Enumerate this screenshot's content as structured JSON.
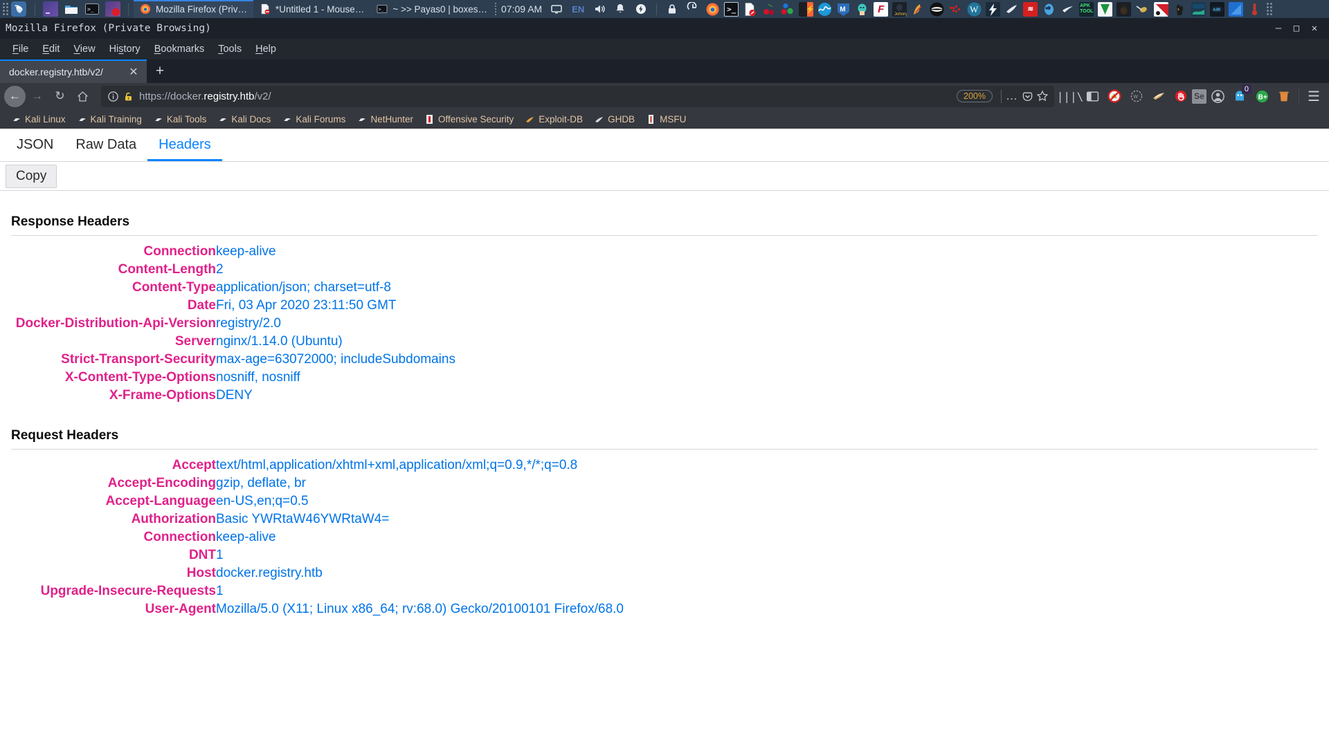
{
  "taskbar": {
    "grip_icon": "drag-grip-icon",
    "kali_logo": "kali-dragon-logo",
    "launchers": [
      {
        "name": "terminal-emulator-launcher",
        "icon": "monitor-purple-icon"
      },
      {
        "name": "file-manager-launcher",
        "icon": "folder-icon"
      },
      {
        "name": "terminal-launcher",
        "icon": "terminal-icon"
      },
      {
        "name": "screen-recorder-launcher",
        "icon": "monitor-record-icon"
      }
    ],
    "windows": [
      {
        "label": "Mozilla Firefox (Priv…",
        "icon": "firefox-icon",
        "active": true
      },
      {
        "label": "*Untitled 1 - Mouse…",
        "icon": "mousepad-icon",
        "active": false
      },
      {
        "label": "~ >> Payas0 | boxes…",
        "icon": "terminal-icon",
        "active": false
      }
    ],
    "clock": "07:09 AM",
    "tray": [
      {
        "name": "display-icon",
        "glyph": "⬜"
      },
      {
        "name": "keyboard-language-indicator",
        "glyph": "EN"
      },
      {
        "name": "volume-icon",
        "glyph": "🔊"
      },
      {
        "name": "notifications-bell-icon",
        "glyph": "🔔"
      },
      {
        "name": "power-manager-icon",
        "glyph": "⚡"
      },
      {
        "name": "lock-screen-icon",
        "glyph": "🔒"
      },
      {
        "name": "logout-icon",
        "glyph": "↪"
      }
    ],
    "app_icons": [
      {
        "name": "firefox-app-icon",
        "color": "#e8651a",
        "glyph": "🦊"
      },
      {
        "name": "terminal-app-icon",
        "color": "#101418",
        "glyph": ">_"
      },
      {
        "name": "no-document-app-icon",
        "color": "#f2f2f2",
        "glyph": "⊘"
      },
      {
        "name": "cherrytree-app-icon",
        "color": "#c8102e",
        "glyph": "❥"
      },
      {
        "name": "bloodhound-app-icon",
        "color": "#1c74d4",
        "glyph": "●"
      },
      {
        "name": "burpsuite-app-icon",
        "color": "#ff6633",
        "glyph": "⚡"
      },
      {
        "name": "wireshark-app-icon",
        "color": "#1d98d9",
        "glyph": "∿"
      },
      {
        "name": "metasploit-app-icon",
        "color": "#2c6dbb",
        "glyph": "M"
      },
      {
        "name": "beef-app-icon",
        "color": "#39b9b0",
        "glyph": "🐮"
      },
      {
        "name": "faraday-app-icon",
        "color": "#c41230",
        "glyph": "F"
      },
      {
        "name": "johnny-app-icon",
        "color": "#1a1a1a",
        "glyph": "J"
      },
      {
        "name": "hydra-app-icon",
        "color": "#b8341a",
        "glyph": "H"
      },
      {
        "name": "anonymous-app-icon",
        "color": "#111111",
        "glyph": "◑"
      },
      {
        "name": "sqlmap-app-icon",
        "color": "#d42020",
        "glyph": "⌨"
      },
      {
        "name": "wordpress-wpscan-app-icon",
        "color": "#21759b",
        "glyph": "W"
      },
      {
        "name": "zaproxy-app-icon",
        "color": "#1b4f8c",
        "glyph": "⚡"
      },
      {
        "name": "sqlninja-app-icon",
        "color": "#2b3a42",
        "glyph": "✒"
      },
      {
        "name": "nikto-app-icon",
        "color": "#cc0000",
        "glyph": "≣"
      },
      {
        "name": "maltego-app-icon",
        "color": "#3b8ed0",
        "glyph": "○"
      },
      {
        "name": "recon-ng-app-icon",
        "color": "#e8e8e8",
        "glyph": "➤"
      },
      {
        "name": "apktool-app-icon",
        "color": "#2f8f4e",
        "glyph": "A"
      },
      {
        "name": "vim-app-icon",
        "color": "#19953d",
        "glyph": "V"
      },
      {
        "name": "beetle-app-icon",
        "color": "#1a1a1a",
        "glyph": "🐜"
      },
      {
        "name": "wasp-app-icon",
        "color": "#c8a23b",
        "glyph": "🐝"
      },
      {
        "name": "nmap-app-icon",
        "color": "#d0202a",
        "glyph": "⬤"
      },
      {
        "name": "dogpile-app-icon",
        "color": "#1b1b1b",
        "glyph": "🐕"
      },
      {
        "name": "sparta-app-icon",
        "color": "#17496b",
        "glyph": "▒"
      },
      {
        "name": "airgeddon-app-icon",
        "color": "#101820",
        "glyph": "AIR"
      },
      {
        "name": "armitage-app-icon",
        "color": "#1f6fd0",
        "glyph": "◥"
      },
      {
        "name": "thermometer-app-icon",
        "color": "#c23a2b",
        "glyph": "🌡"
      }
    ],
    "end_grip_icon": "drag-grip-icon"
  },
  "window": {
    "title": "Mozilla Firefox (Private Browsing)",
    "minimize_glyph": "–",
    "maximize_glyph": "□",
    "close_glyph": "✕"
  },
  "menubar": {
    "items": [
      {
        "accel": "F",
        "rest": "ile"
      },
      {
        "accel": "E",
        "rest": "dit"
      },
      {
        "accel": "V",
        "rest": "iew"
      },
      {
        "accel": "Hi",
        "rest": "story",
        "pre": "Hi",
        "mid": "s",
        "post": "tory"
      },
      {
        "accel": "B",
        "rest": "ookmarks"
      },
      {
        "accel": "T",
        "rest": "ools"
      },
      {
        "accel": "H",
        "rest": "elp"
      }
    ],
    "labels": [
      "File",
      "Edit",
      "View",
      "History",
      "Bookmarks",
      "Tools",
      "Help"
    ]
  },
  "tabbar": {
    "tab_title": "docker.registry.htb/v2/",
    "close_glyph": "✕",
    "newtab_glyph": "+"
  },
  "navbar": {
    "back_glyph": "←",
    "forward_glyph": "→",
    "reload_glyph": "↻",
    "home_glyph": "⌂",
    "identity_icon": "info-circle-icon",
    "warning_icon": "broken-lock-warning-icon",
    "url_scheme": "https://",
    "url_subdomain": "docker.",
    "url_domain": "registry.htb",
    "url_path": "/v2/",
    "url_full": "https://docker.registry.htb/v2/",
    "zoom_level": "200%",
    "page_actions_glyph": "…",
    "pocket_glyph": "▽",
    "bookmark_star_glyph": "☆",
    "toolbar_icons": [
      {
        "name": "library-icon",
        "glyph": "|||\\",
        "color": "#c3c9d3"
      },
      {
        "name": "sidebar-icon",
        "glyph": "◫",
        "color": "#c3c9d3"
      },
      {
        "name": "noscript-extension-icon",
        "glyph": "🚫",
        "color": "#d03020"
      },
      {
        "name": "wappalyzer-extension-icon",
        "glyph": "◌",
        "color": "#9aa0aa"
      },
      {
        "name": "foxyproxy-extension-icon",
        "glyph": "🦊",
        "color": "#c9a96b"
      },
      {
        "name": "hacktools-extension-icon",
        "glyph": "✋",
        "color": "#e01b24"
      },
      {
        "name": "selenium-ide-extension-icon",
        "glyph": "Se",
        "color": "#8c8f96"
      },
      {
        "name": "account-avatar-icon",
        "glyph": "◯",
        "color": "#b9bfc9"
      },
      {
        "name": "ghostery-extension-icon",
        "glyph": "👻",
        "color": "#3aa7e0",
        "badge": "0"
      },
      {
        "name": "buster-captcha-extension-icon",
        "glyph": "B+",
        "color": "#2aa84a"
      },
      {
        "name": "clear-data-trash-icon",
        "glyph": "🗑",
        "color": "#e08a3c"
      },
      {
        "name": "app-menu-hamburger-icon",
        "glyph": "☰",
        "color": "#c3c9d3"
      }
    ]
  },
  "bookmarks": {
    "items": [
      {
        "label": "Kali Linux",
        "icon": "kali-dragon-bookmark-icon"
      },
      {
        "label": "Kali Training",
        "icon": "kali-dragon-bookmark-icon"
      },
      {
        "label": "Kali Tools",
        "icon": "kali-dragon-bookmark-icon"
      },
      {
        "label": "Kali Docs",
        "icon": "kali-dragon-bookmark-icon"
      },
      {
        "label": "Kali Forums",
        "icon": "kali-dragon-bookmark-icon"
      },
      {
        "label": "NetHunter",
        "icon": "kali-dragon-bookmark-icon"
      },
      {
        "label": "Offensive Security",
        "icon": "offsec-bookmark-icon"
      },
      {
        "label": "Exploit-DB",
        "icon": "exploitdb-bookmark-icon"
      },
      {
        "label": "GHDB",
        "icon": "ghdb-bookmark-icon"
      },
      {
        "label": "MSFU",
        "icon": "msfu-bookmark-icon"
      }
    ]
  },
  "viewer": {
    "tabs": [
      {
        "label": "JSON",
        "selected": false
      },
      {
        "label": "Raw Data",
        "selected": false
      },
      {
        "label": "Headers",
        "selected": true
      }
    ],
    "copy_label": "Copy",
    "response_title": "Response Headers",
    "request_title": "Request Headers",
    "response_headers": [
      {
        "name": "Connection",
        "value": "keep-alive"
      },
      {
        "name": "Content-Length",
        "value": "2"
      },
      {
        "name": "Content-Type",
        "value": "application/json; charset=utf-8"
      },
      {
        "name": "Date",
        "value": "Fri, 03 Apr 2020 23:11:50 GMT"
      },
      {
        "name": "Docker-Distribution-Api-Version",
        "value": "registry/2.0"
      },
      {
        "name": "Server",
        "value": "nginx/1.14.0 (Ubuntu)"
      },
      {
        "name": "Strict-Transport-Security",
        "value": "max-age=63072000; includeSubdomains"
      },
      {
        "name": "X-Content-Type-Options",
        "value": "nosniff, nosniff"
      },
      {
        "name": "X-Frame-Options",
        "value": "DENY"
      }
    ],
    "request_headers": [
      {
        "name": "Accept",
        "value": "text/html,application/xhtml+xml,application/xml;q=0.9,*/*;q=0.8"
      },
      {
        "name": "Accept-Encoding",
        "value": "gzip, deflate, br"
      },
      {
        "name": "Accept-Language",
        "value": "en-US,en;q=0.5"
      },
      {
        "name": "Authorization",
        "value": "Basic YWRtaW46YWRtaW4="
      },
      {
        "name": "Connection",
        "value": "keep-alive"
      },
      {
        "name": "DNT",
        "value": "1"
      },
      {
        "name": "Host",
        "value": "docker.registry.htb"
      },
      {
        "name": "Upgrade-Insecure-Requests",
        "value": "1"
      },
      {
        "name": "User-Agent",
        "value": "Mozilla/5.0 (X11; Linux x86_64; rv:68.0) Gecko/20100101 Firefox/68.0"
      }
    ]
  },
  "colors": {
    "header_name": "#e0218a",
    "header_value": "#0074e8",
    "accent": "#0a84ff",
    "taskbar_bg": "#2c3e50"
  }
}
